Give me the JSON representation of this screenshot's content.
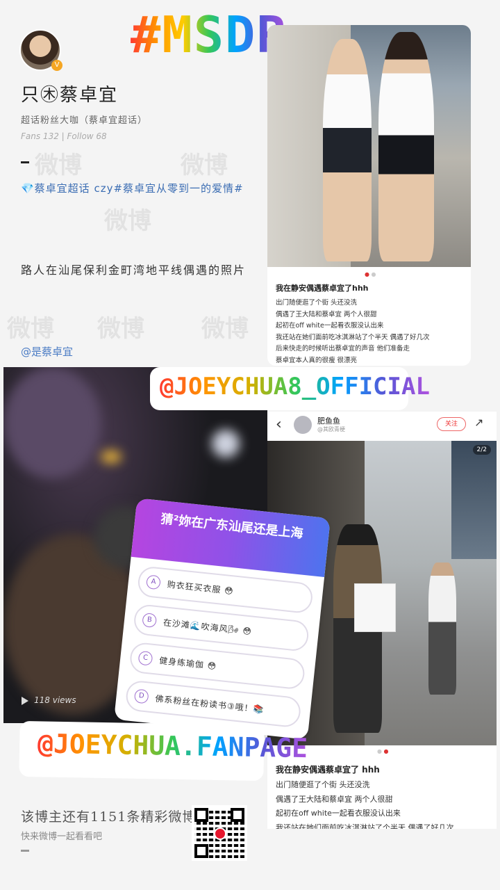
{
  "hashtag": "#MSDR",
  "profile": {
    "name": "只㊍蔡卓宜",
    "bio": "超话粉丝大咖（蔡卓宜超话）",
    "fans": "Fans 132",
    "follow": "Follow 68",
    "tags": "💎蔡卓宜超话 czy#蔡卓宜从零到一的爱情#",
    "post": "路人在汕尾保利金町湾地平线偶遇的照片",
    "mention": "@是蔡卓宜"
  },
  "card1": {
    "title": "我在静安偶遇蔡卓宜了hhh",
    "lines": [
      "出门随便逛了个街 头还没洗",
      "偶遇了王大陆和蔡卓宜 两个人很甜",
      "起初在off white一起看衣服没认出来",
      "我还站在她们面前吃冰淇淋站了个半天 偶遇了好几次",
      "后来快走的时候听出蔡卓宜的声音 他们准备走",
      "蔡卓宜本人真的很瘦 很漂亮"
    ]
  },
  "video": {
    "views": "118 views"
  },
  "tag_official": "@JOEYCHUA8_OFFICIAL",
  "tag_fanpage": "@JOEYCHUA.FANPAGE",
  "card2": {
    "user": "肥鱼鱼",
    "sub": "@其欧青梗",
    "follow_label": "关注",
    "page": "2/2",
    "title": "我在静安偶遇蔡卓宜了 hhh",
    "lines": [
      "出门随便逛了个街 头还没洗",
      "偶遇了王大陆和蔡卓宜 两个人很甜",
      "起初在off white一起看衣服没认出来",
      "我还站在她们面前吃冰淇淋站了个半天 偶遇了好几次"
    ]
  },
  "quiz": {
    "question": "猜²妳在广东汕尾还是上海",
    "options": [
      {
        "letter": "A",
        "text": "购衣狂买衣服 😳"
      },
      {
        "letter": "B",
        "text": "在沙滩🌊吹海风🌬 😳"
      },
      {
        "letter": "C",
        "text": "健身练瑜伽 😳"
      },
      {
        "letter": "D",
        "text": "佛系粉丝在粉读书③哦！📚"
      }
    ]
  },
  "footer": {
    "line1": "该博主还有1151条精彩微博",
    "line2": "快来微博一起看看吧"
  }
}
